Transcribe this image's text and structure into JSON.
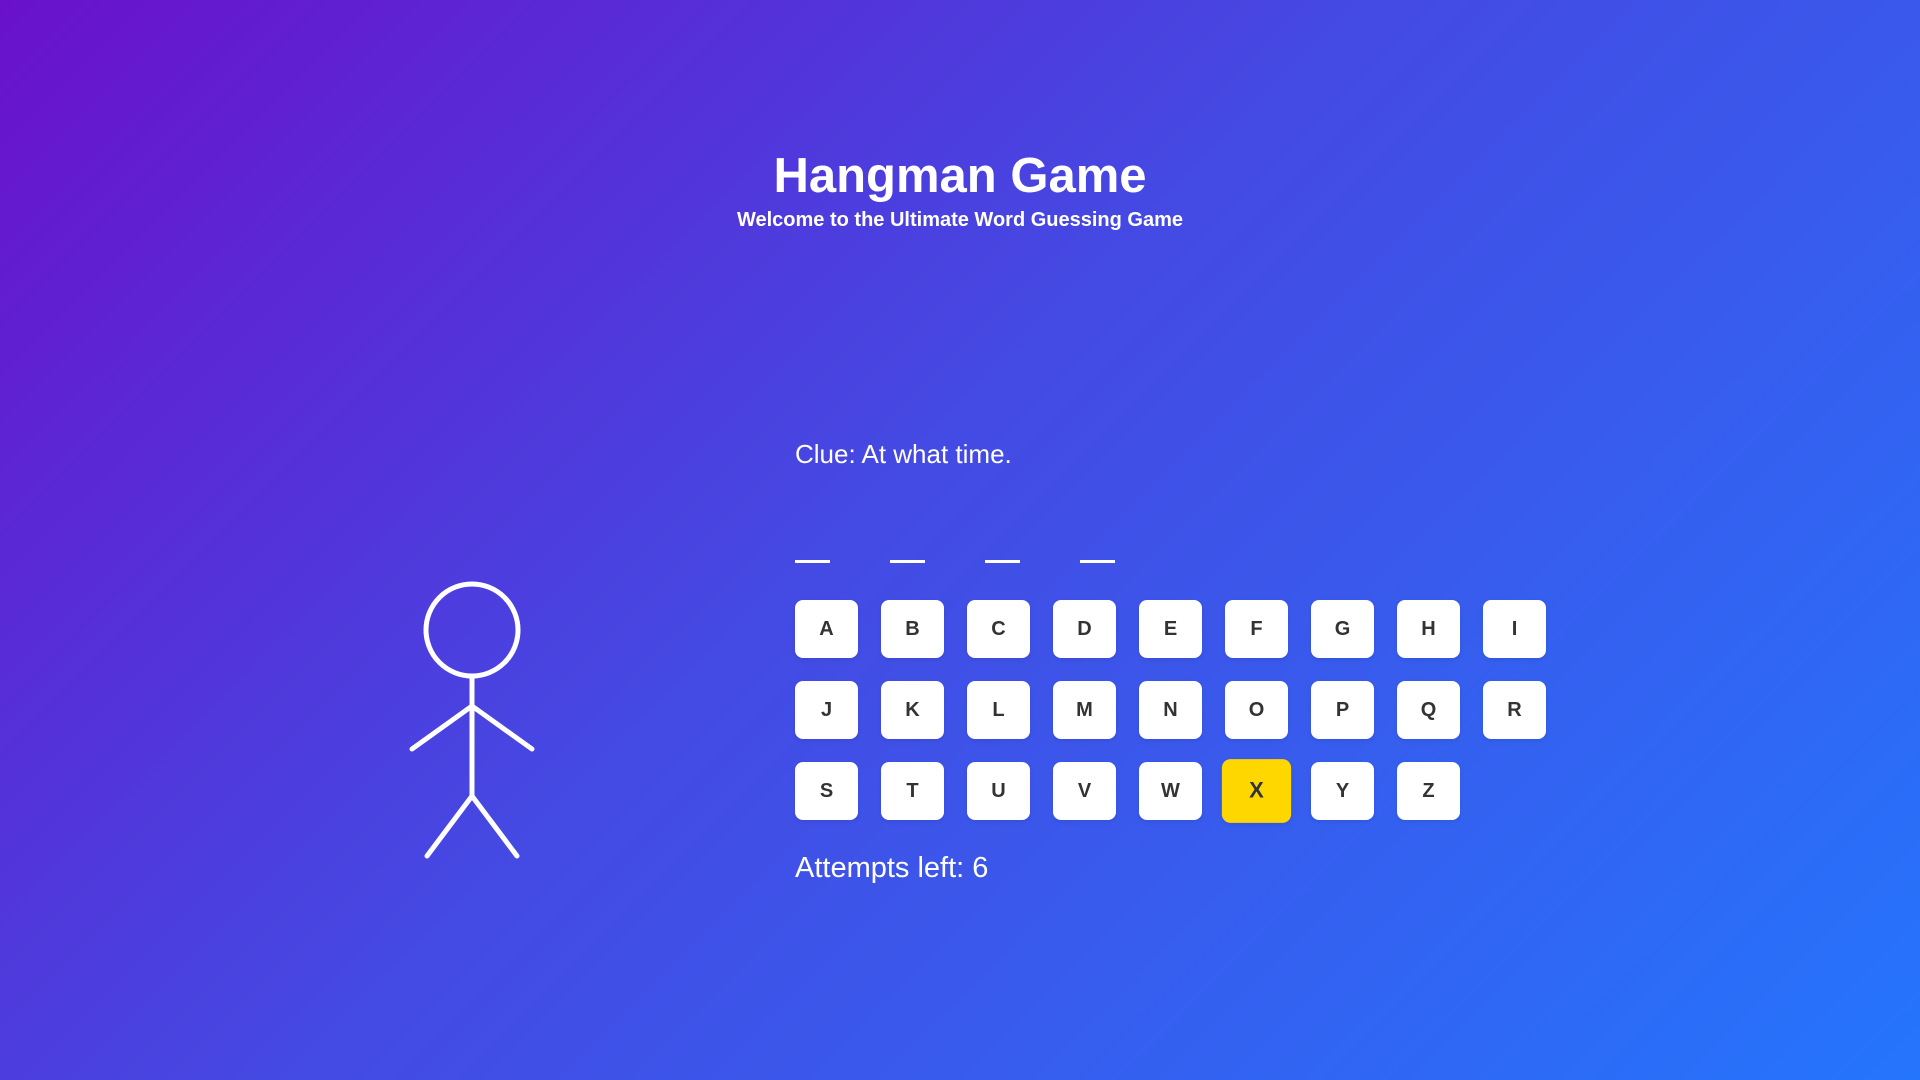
{
  "header": {
    "title": "Hangman Game",
    "subtitle": "Welcome to the Ultimate Word Guessing Game"
  },
  "clue": "Clue: At what time.",
  "word": {
    "blanks": [
      "_",
      "_",
      "_",
      "_"
    ]
  },
  "keyboard": {
    "letters": [
      "A",
      "B",
      "C",
      "D",
      "E",
      "F",
      "G",
      "H",
      "I",
      "J",
      "K",
      "L",
      "M",
      "N",
      "O",
      "P",
      "Q",
      "R",
      "S",
      "T",
      "U",
      "V",
      "W",
      "X",
      "Y",
      "Z"
    ],
    "highlighted": "X",
    "highlight_color": "#ffd700",
    "key_color": "#ffffff",
    "key_text_color": "#333333"
  },
  "attempts": "Attempts left: 6",
  "figure": {
    "icon": "stick-figure-icon",
    "parts_shown": [
      "head",
      "body",
      "left-arm",
      "right-arm",
      "left-leg",
      "right-leg"
    ]
  },
  "colors": {
    "gradient_start": "#6a11cb",
    "gradient_end": "#2575fc",
    "text": "#ffffff"
  }
}
